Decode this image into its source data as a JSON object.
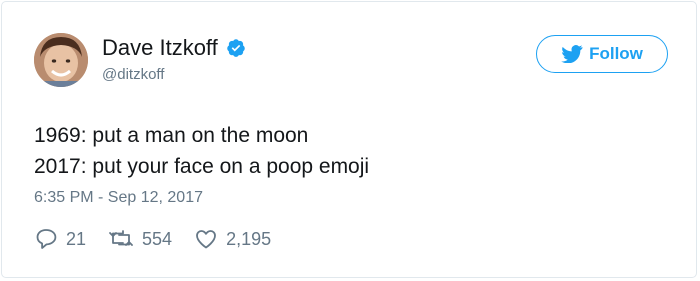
{
  "author": {
    "display_name": "Dave Itzkoff",
    "handle": "@ditzkoff",
    "verified": true,
    "avatar_icon": "profile-photo"
  },
  "follow_button": {
    "label": "Follow",
    "icon": "twitter-bird-icon"
  },
  "tweet": {
    "lines": [
      "1969: put a man on the moon",
      "2017: put your face on a poop emoji"
    ],
    "timestamp": "6:35 PM - Sep 12, 2017"
  },
  "actions": {
    "replies": "21",
    "retweets": "554",
    "likes": "2,195"
  },
  "colors": {
    "accent": "#1da1f2",
    "text": "#14171a",
    "muted": "#657786",
    "border": "#e1e8ed"
  }
}
